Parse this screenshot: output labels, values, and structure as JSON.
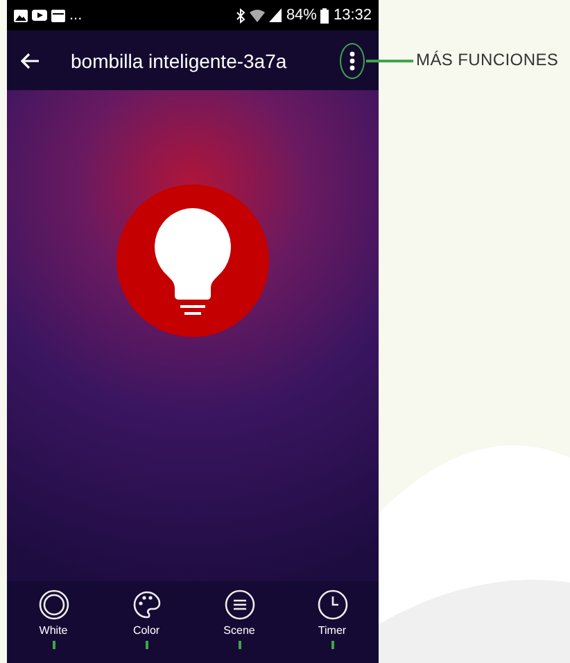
{
  "status_bar": {
    "overflow": "...",
    "battery": "84%",
    "time": "13:32"
  },
  "app_bar": {
    "title": "bombilla inteligente-3a7a"
  },
  "callout": {
    "label": "MÁS FUNCIONES"
  },
  "bottom_tabs": [
    {
      "kind": "white",
      "label": "White"
    },
    {
      "kind": "color",
      "label": "Color"
    },
    {
      "kind": "scene",
      "label": "Scene"
    },
    {
      "kind": "timer",
      "label": "Timer"
    }
  ]
}
